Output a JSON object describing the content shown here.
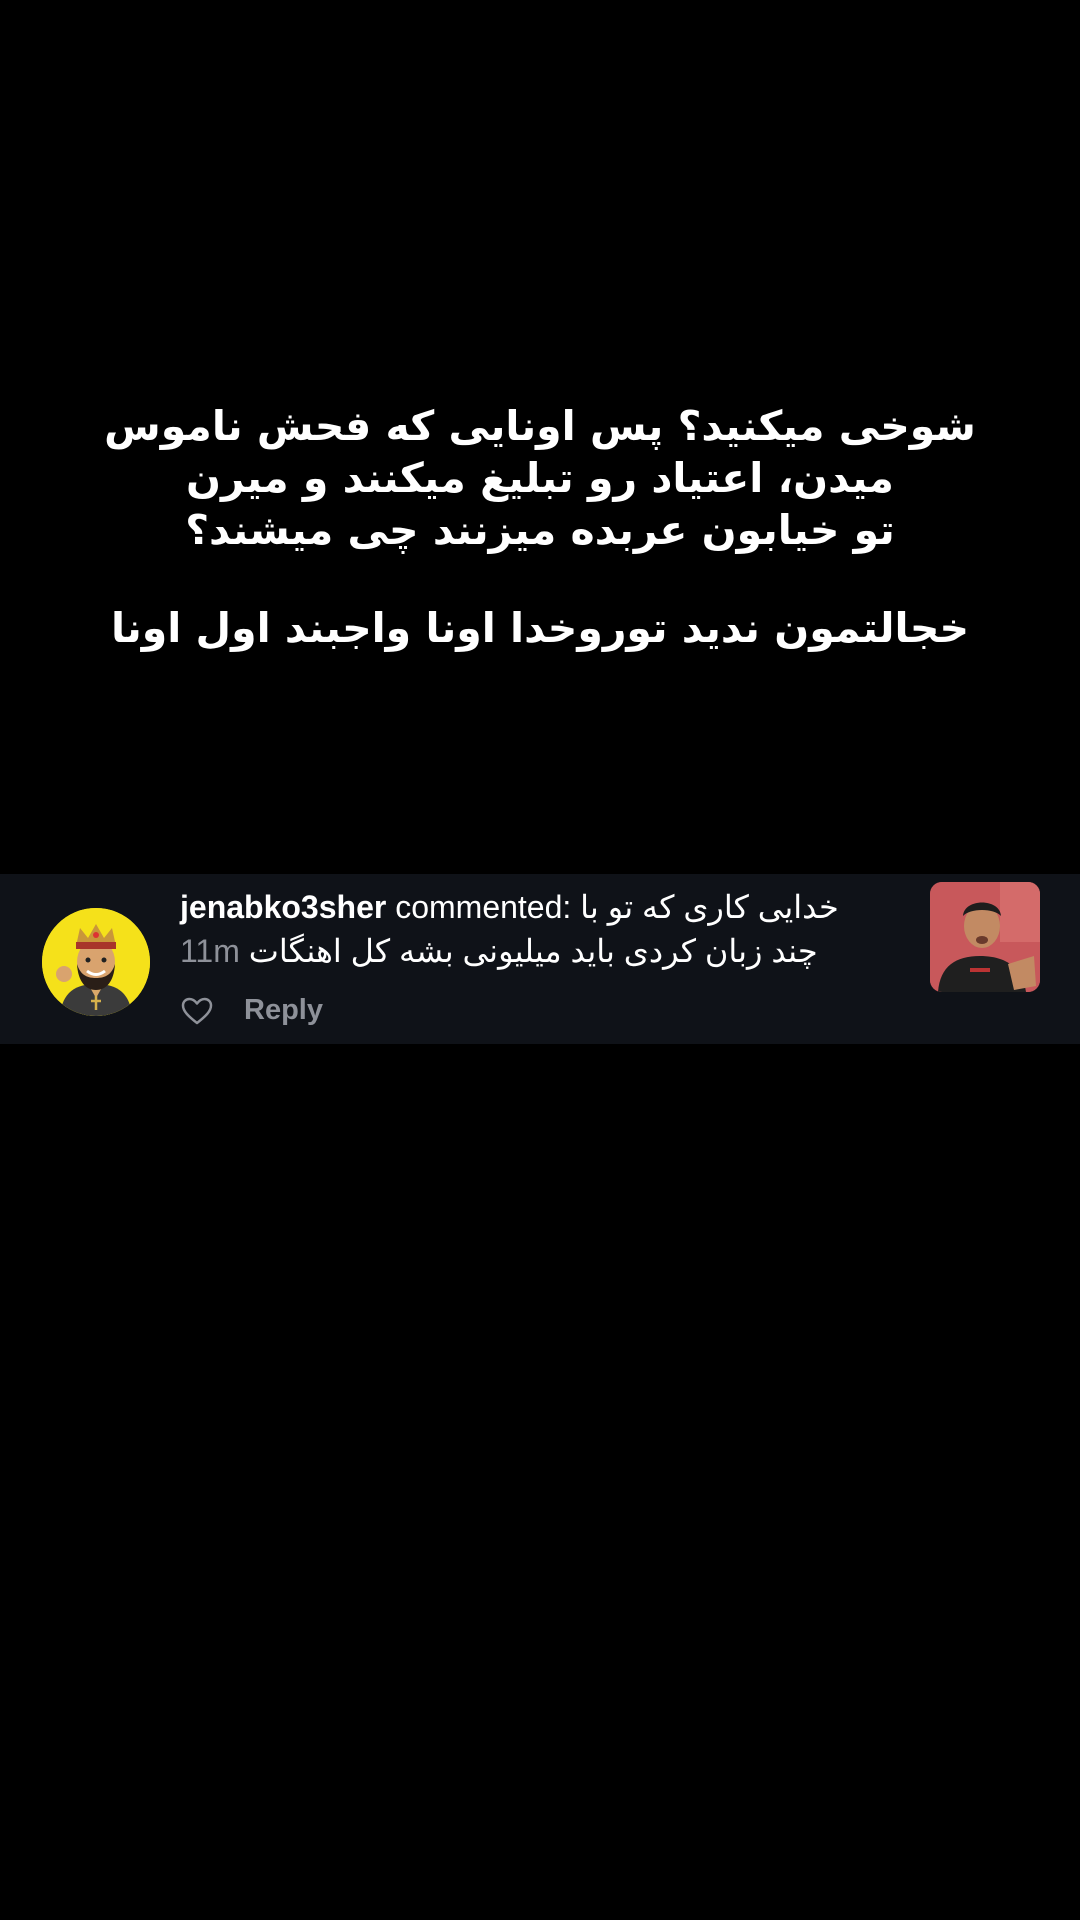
{
  "story": {
    "lines": [
      "شوخی میکنید؟ پس اونایی که فحش ناموس",
      "میدن، اعتیاد رو تبلیغ میکنند و میرن",
      "تو خیابون عربده میزنند چی میشند؟",
      "خجالتمون ندید توروخدا اونا واجبند اول اونا"
    ]
  },
  "comment": {
    "username": "jenabko3sher",
    "verb": "commented:",
    "text_part1": "خدایی کاری که تو با",
    "text_part2": "چند زبان کردی باید میلیونی بشه کل اهنگات",
    "time": "11m",
    "reply_label": "Reply",
    "avatar_icon": "crowned-man-avatar-icon",
    "thumbnail_icon": "video-thumbnail-man-icon",
    "like_icon": "heart-outline-icon"
  },
  "colors": {
    "background": "#000000",
    "card": "#0f1218",
    "text": "#ffffff",
    "muted": "#8e9199",
    "avatar_bg": "#f5e11a"
  }
}
